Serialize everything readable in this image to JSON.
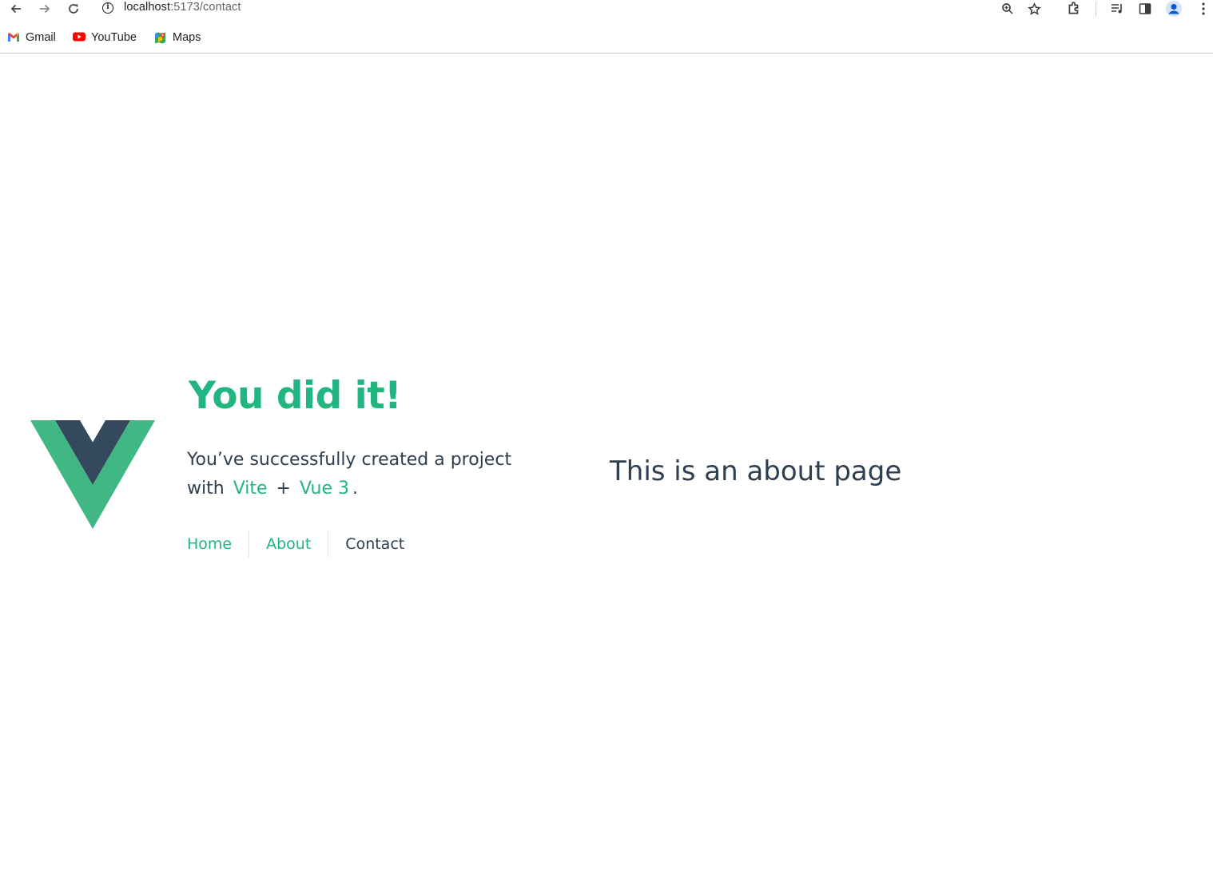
{
  "browser": {
    "url_host": "localhost",
    "url_path": ":5173/contact",
    "nav_icons": {
      "back": "back-arrow-icon",
      "forward": "forward-arrow-icon",
      "reload": "reload-icon"
    },
    "bookmarks": [
      {
        "label": "Gmail",
        "icon": "gmail-icon"
      },
      {
        "label": "YouTube",
        "icon": "youtube-icon"
      },
      {
        "label": "Maps",
        "icon": "maps-icon"
      }
    ]
  },
  "hero": {
    "title": "You did it!",
    "subtitle_prefix": "You’ve successfully created a project with",
    "link_vite": "Vite",
    "plus": "+",
    "link_vue": "Vue 3",
    "suffix": "."
  },
  "nav": {
    "items": [
      {
        "label": "Home",
        "active": false
      },
      {
        "label": "About",
        "active": false
      },
      {
        "label": "Contact",
        "active": true
      }
    ]
  },
  "main": {
    "heading": "This is an about page"
  },
  "colors": {
    "accent": "#21b57f",
    "text": "#2c3e50",
    "logo_green": "#41b883",
    "logo_dark": "#34495e"
  }
}
